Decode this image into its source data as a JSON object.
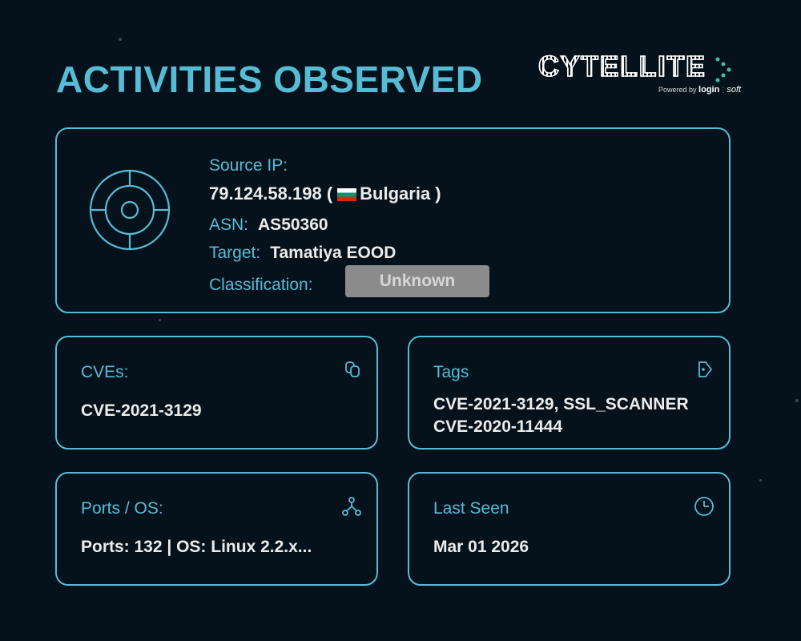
{
  "header": {
    "title": "ACTIVITIES OBSERVED",
    "logo": {
      "name": "CYTELLITE",
      "powered_by": "Powered by",
      "brand_a": "login",
      "brand_b": "soft"
    }
  },
  "summary": {
    "source_ip_label": "Source IP:",
    "ip": "79.124.58.198",
    "country": "Bulgaria",
    "paren_open": " (",
    "paren_close": " )",
    "asn_label": "ASN:",
    "asn": "AS50360",
    "target_label": "Target:",
    "target": "Tamatiya EOOD",
    "classification_label": "Classification:",
    "classification": "Unknown"
  },
  "cards": {
    "cves": {
      "label": "CVEs:",
      "value": "CVE-2021-3129",
      "icon": "copy-icon"
    },
    "tags": {
      "label": "Tags",
      "values": [
        "CVE-2021-3129, SSL_SCANNER",
        "CVE-2020-11444"
      ],
      "icon": "tag-icon"
    },
    "ports": {
      "label": "Ports / OS:",
      "value": "Ports: 132 | OS: Linux 2.2.x...",
      "icon": "network-icon"
    },
    "last_seen": {
      "label": "Last Seen",
      "value": "Mar 01 2026",
      "icon": "clock-icon"
    }
  },
  "colors": {
    "background": "#06121b",
    "accent": "#56bcd6",
    "text": "#ececec",
    "badge": "#8b8b8b"
  }
}
